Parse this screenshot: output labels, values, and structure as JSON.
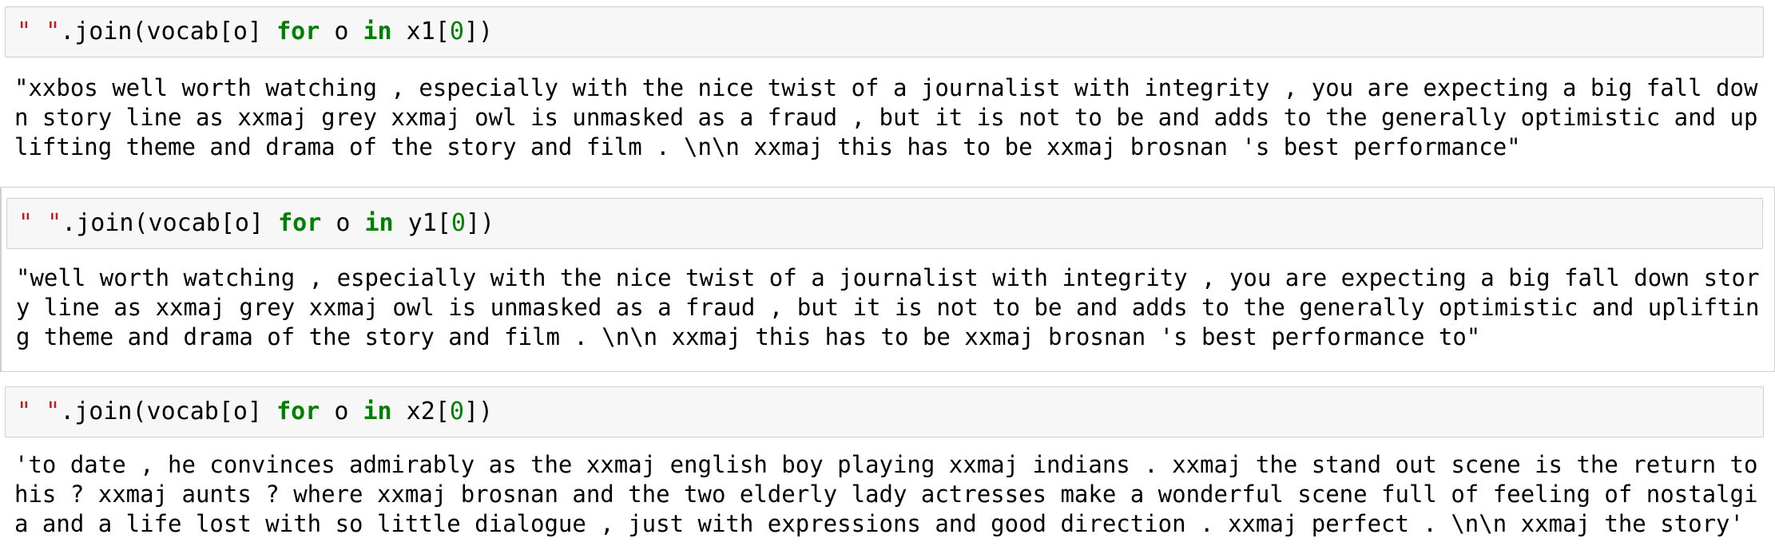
{
  "cells": [
    {
      "code": {
        "str": "\" \"",
        "pre": ".join(vocab[o] ",
        "kw1": "for",
        "mid": " o ",
        "kw2": "in",
        "var": " x1[",
        "num": "0",
        "post": "])"
      },
      "output_lines": [
        "\"xxbos well worth watching , especially with the nice twist of a journalist with integrity , you are expecting a big fall dow",
        "n story line as xxmaj grey xxmaj owl is unmasked as a fraud , but it is not to be and adds to the generally optimistic and up",
        "lifting theme and drama of the story and film . \\n\\n xxmaj this has to be xxmaj brosnan 's best performance\""
      ]
    },
    {
      "code": {
        "str": "\" \"",
        "pre": ".join(vocab[o] ",
        "kw1": "for",
        "mid": " o ",
        "kw2": "in",
        "var": " y1[",
        "num": "0",
        "post": "])"
      },
      "output_lines": [
        "\"well worth watching , especially with the nice twist of a journalist with integrity , you are expecting a big fall down stor",
        "y line as xxmaj grey xxmaj owl is unmasked as a fraud , but it is not to be and adds to the generally optimistic and upliftin",
        "g theme and drama of the story and film . \\n\\n xxmaj this has to be xxmaj brosnan 's best performance to\""
      ]
    },
    {
      "code": {
        "str": "\" \"",
        "pre": ".join(vocab[o] ",
        "kw1": "for",
        "mid": " o ",
        "kw2": "in",
        "var": " x2[",
        "num": "0",
        "post": "])"
      },
      "output_lines": [
        "'to date , he convinces admirably as the xxmaj english boy playing xxmaj indians . xxmaj the stand out scene is the return to",
        "his ? xxmaj aunts ? where xxmaj brosnan and the two elderly lady actresses make a wonderful scene full of feeling of nostalgi",
        "a and a life lost with so little dialogue , just with expressions and good direction . xxmaj perfect . \\n\\n xxmaj the story'"
      ]
    }
  ]
}
